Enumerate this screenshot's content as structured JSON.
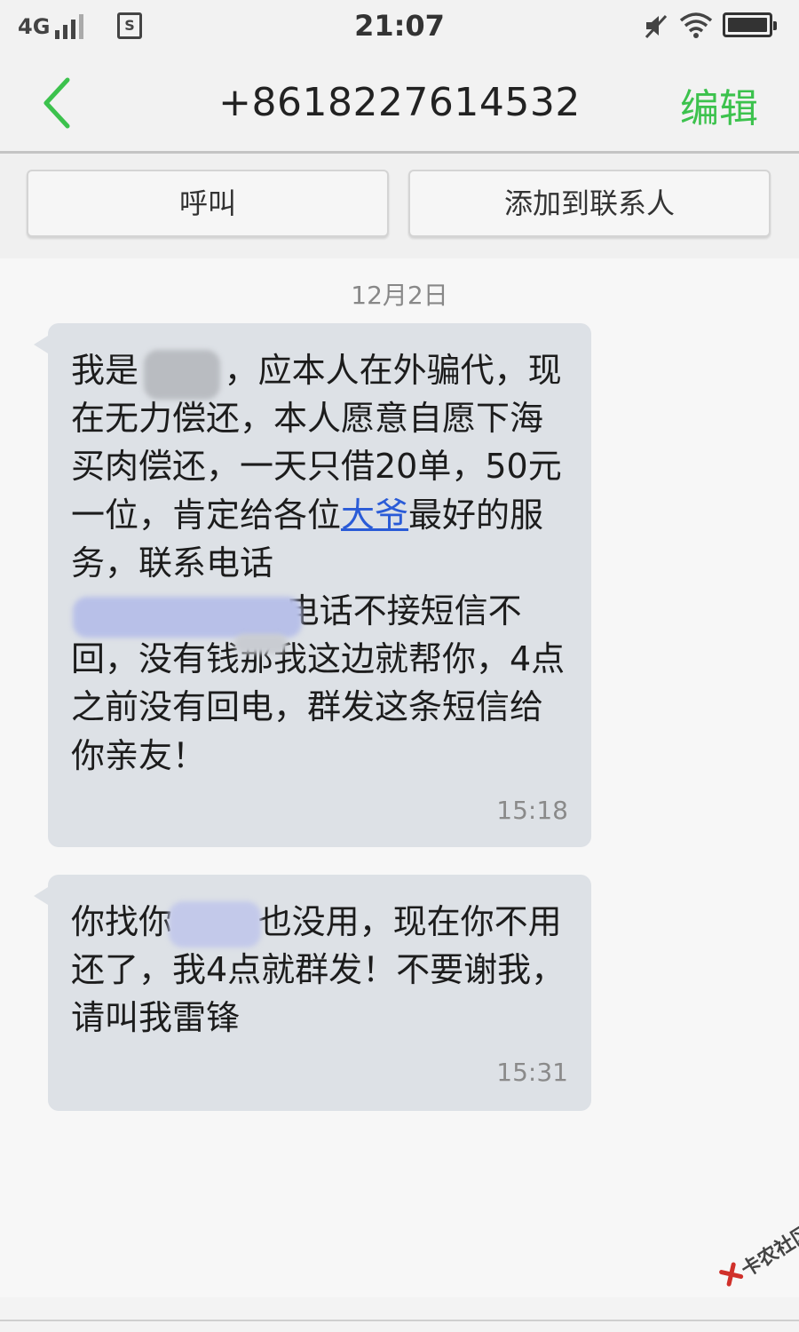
{
  "status_bar": {
    "network": "4G",
    "time": "21:07",
    "sim_label": "S"
  },
  "header": {
    "title": "+8618227614532",
    "edit_label": "编辑"
  },
  "actions": {
    "call_label": "呼叫",
    "add_contact_label": "添加到联系人"
  },
  "conversation": {
    "date": "12月2日",
    "messages": [
      {
        "text_before_link": "我是        ，应本人在外骗代，现在无力偿还，本人愿意自愿下海买肉偿还，一天只借20单，50元一位，肯定给各位",
        "link_text": "大爷",
        "text_after_link": "最好的服务，联系电话\n                    电话不接短信不回，没有钱那我这边就帮你，4点之前没有回电，群发这条短信给你亲友！",
        "time": "15:18"
      },
      {
        "text": "你找你        也没用，现在你不用还了，我4点就群发！不要谢我，请叫我雷锋",
        "time": "15:31"
      }
    ]
  },
  "watermark": "卡农社区",
  "colors": {
    "accent_green": "#3cc24d",
    "bubble_bg": "#dde1e6",
    "link_blue": "#2a5bd7"
  }
}
